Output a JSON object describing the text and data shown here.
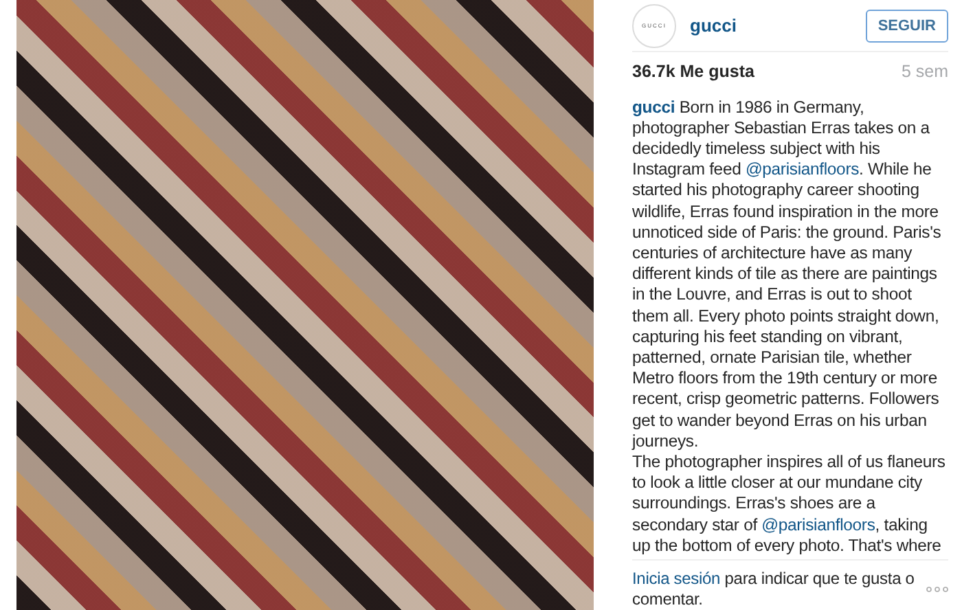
{
  "post": {
    "avatar_text": "GUCCI",
    "username": "gucci",
    "follow_button": "SEGUIR",
    "likes": "36.7k Me gusta",
    "time": "5 sem",
    "caption": [
      {
        "kind": "user",
        "text": "gucci"
      },
      {
        "kind": "text",
        "text": " Born in 1986 in Germany, photographer Sebastian Erras takes on a decidedly timeless subject with his Instagram feed "
      },
      {
        "kind": "link",
        "text": "@parisianfloors"
      },
      {
        "kind": "text",
        "text": ". While he started his photography career shooting wildlife, Erras found inspiration in the more unnoticed side of Paris: the ground. Paris's centuries of architecture have as many different kinds of tile as there are paintings in the Louvre, and Erras is out to shoot them all. Every photo points straight down, capturing his feet standing on vibrant, patterned, ornate Parisian tile, whether Metro floors from the 19th century or more recent, crisp geometric patterns. Followers get to wander beyond Erras on his urban journeys."
      },
      {
        "kind": "break"
      },
      {
        "kind": "text",
        "text": "The photographer inspires all of us flaneurs to look a little closer at our mundane city surroundings. Erras's shoes are a secondary star of "
      },
      {
        "kind": "link",
        "text": "@parisianfloors"
      },
      {
        "kind": "text",
        "text": ", taking up the bottom of every photo. That's where"
      }
    ],
    "login_link": "Inicia sesión",
    "login_text": " para indicar que te gusta o comentar."
  }
}
